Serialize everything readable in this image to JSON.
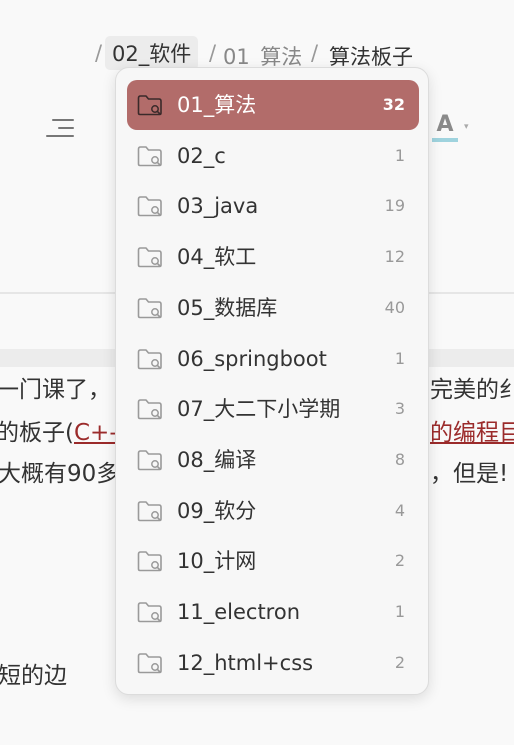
{
  "breadcrumb": {
    "sep": "/",
    "current": "02_软件",
    "item1": "01_算法",
    "item2": "算法板子"
  },
  "toolbar": {
    "font_label": "A"
  },
  "dropdown": {
    "items": [
      {
        "label": "01_算法",
        "count": "32",
        "icon": "folder-search-icon"
      },
      {
        "label": "02_c",
        "count": "1",
        "icon": "folder-search-icon"
      },
      {
        "label": "03_java",
        "count": "19",
        "icon": "folder-search-icon"
      },
      {
        "label": "04_软工",
        "count": "12",
        "icon": "folder-search-icon"
      },
      {
        "label": "05_数据库",
        "count": "40",
        "icon": "folder-search-icon"
      },
      {
        "label": "06_springboot",
        "count": "1",
        "icon": "folder-search-icon"
      },
      {
        "label": "07_大二下小学期",
        "count": "3",
        "icon": "folder-search-icon"
      },
      {
        "label": "08_编译",
        "count": "8",
        "icon": "folder-search-icon"
      },
      {
        "label": "09_软分",
        "count": "4",
        "icon": "folder-search-icon"
      },
      {
        "label": "10_计网",
        "count": "2",
        "icon": "folder-search-icon"
      },
      {
        "label": "11_electron",
        "count": "1",
        "icon": "folder-search-icon"
      },
      {
        "label": "12_html+css",
        "count": "2",
        "icon": "folder-search-icon"
      }
    ],
    "active_index": 0
  },
  "document": {
    "line1_left": "一门课了，",
    "line1_right": "完美的纟",
    "line2_left": "的板子(",
    "line2_link": "C+-",
    "line2_right_link": "的编程目",
    "line3_left": "大概有90多",
    "line3_right": "，但是!",
    "line4": "短的边"
  },
  "colors": {
    "active_row": "#b26c6a",
    "link": "#9b2b2b",
    "font_underline": "#9fd3de"
  }
}
